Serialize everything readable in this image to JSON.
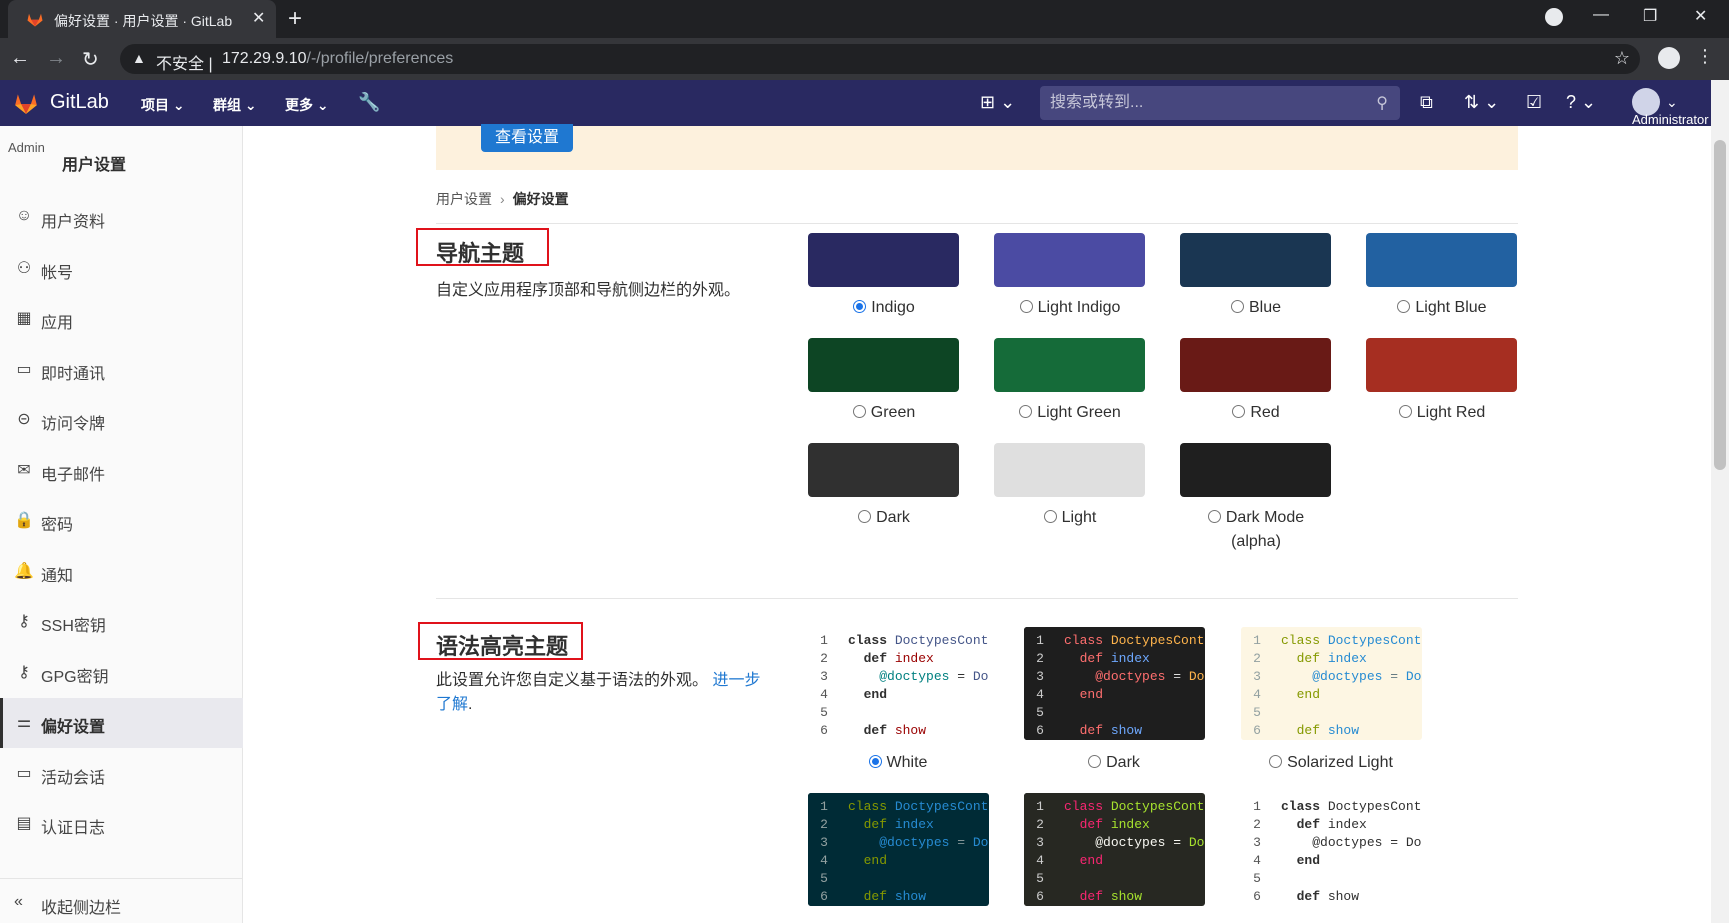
{
  "browser": {
    "tab_title": "偏好设置 · 用户设置 · GitLab",
    "insecure_label": "不安全 |",
    "url_host": "172.29.9.10",
    "url_path": "/-/profile/preferences"
  },
  "header": {
    "brand": "GitLab",
    "nav": [
      "项目",
      "群组",
      "更多"
    ],
    "search_placeholder": "搜索或转到...",
    "user_label": "Administrator"
  },
  "sidebar": {
    "avatar_alt": "Admin",
    "title": "用户设置",
    "items": [
      {
        "label": "用户资料",
        "icon": "user-circle-icon"
      },
      {
        "label": "帐号",
        "icon": "account-icon"
      },
      {
        "label": "应用",
        "icon": "applications-icon"
      },
      {
        "label": "即时通讯",
        "icon": "chat-icon"
      },
      {
        "label": "访问令牌",
        "icon": "token-icon"
      },
      {
        "label": "电子邮件",
        "icon": "mail-icon"
      },
      {
        "label": "密码",
        "icon": "lock-icon"
      },
      {
        "label": "通知",
        "icon": "bell-icon"
      },
      {
        "label": "SSH密钥",
        "icon": "key-icon"
      },
      {
        "label": "GPG密钥",
        "icon": "key-icon"
      },
      {
        "label": "偏好设置",
        "icon": "preferences-icon",
        "active": true
      },
      {
        "label": "活动会话",
        "icon": "monitor-icon"
      },
      {
        "label": "认证日志",
        "icon": "log-icon"
      }
    ],
    "collapse_label": "收起侧边栏"
  },
  "banner": {
    "button_label": "查看设置"
  },
  "breadcrumb": {
    "parent": "用户设置",
    "current": "偏好设置"
  },
  "nav_theme": {
    "title": "导航主题",
    "description": "自定义应用程序顶部和导航侧边栏的外观。",
    "options": [
      {
        "label": "Indigo",
        "color": "#292961",
        "selected": true
      },
      {
        "label": "Light Indigo",
        "color": "#4b4ba3",
        "selected": false
      },
      {
        "label": "Blue",
        "color": "#1a3652",
        "selected": false
      },
      {
        "label": "Light Blue",
        "color": "#2261a1",
        "selected": false
      },
      {
        "label": "Green",
        "color": "#0d4524",
        "selected": false
      },
      {
        "label": "Light Green",
        "color": "#156b39",
        "selected": false
      },
      {
        "label": "Red",
        "color": "#691a16",
        "selected": false
      },
      {
        "label": "Light Red",
        "color": "#a62e21",
        "selected": false
      },
      {
        "label": "Dark",
        "color": "#303030",
        "selected": false
      },
      {
        "label": "Light",
        "color": "#dfdfdf",
        "selected": false
      },
      {
        "label": "Dark Mode\n(alpha)",
        "color": "#1f1f1f",
        "selected": false
      }
    ]
  },
  "syntax_theme": {
    "title": "语法高亮主题",
    "description": "此设置允许您自定义基于语法的外观。",
    "learn_more": "进一步了解",
    "code_lines": [
      "class DoctypesCont",
      "  def index",
      "    @doctypes = Do",
      "  end",
      "",
      "  def show"
    ],
    "options": [
      {
        "label": "White",
        "selected": true
      },
      {
        "label": "Dark",
        "selected": false
      },
      {
        "label": "Solarized Light",
        "selected": false
      }
    ]
  }
}
